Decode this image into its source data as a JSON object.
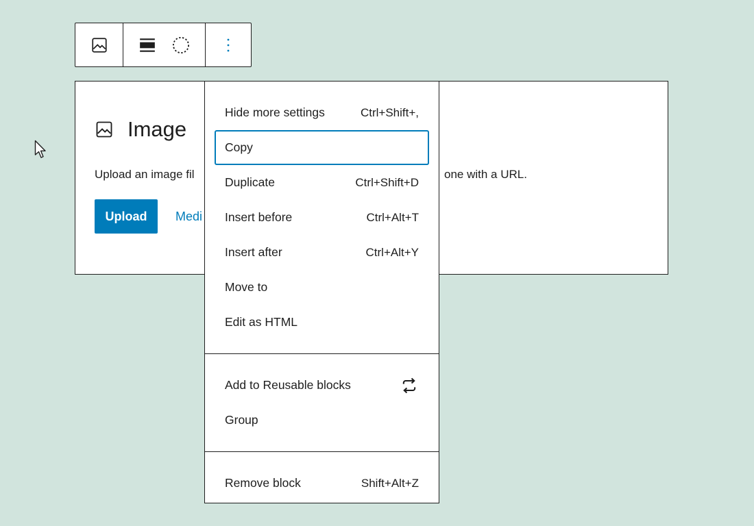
{
  "toolbar": {
    "buttons": [
      {
        "icon": "image-icon"
      },
      {
        "icon": "align-full-width-icon"
      },
      {
        "icon": "duotone-circle-icon"
      },
      {
        "icon": "more-options-icon"
      }
    ]
  },
  "block": {
    "title": "Image",
    "instructions": "Upload an image fil",
    "url_tail": "one with a URL.",
    "upload_label": "Upload",
    "media_label": "Medi"
  },
  "menu": {
    "group1": [
      {
        "label": "Hide more settings",
        "shortcut": "Ctrl+Shift+,"
      },
      {
        "label": "Copy",
        "shortcut": ""
      },
      {
        "label": "Duplicate",
        "shortcut": "Ctrl+Shift+D"
      },
      {
        "label": "Insert before",
        "shortcut": "Ctrl+Alt+T"
      },
      {
        "label": "Insert after",
        "shortcut": "Ctrl+Alt+Y"
      },
      {
        "label": "Move to",
        "shortcut": ""
      },
      {
        "label": "Edit as HTML",
        "shortcut": ""
      }
    ],
    "group2": [
      {
        "label": "Add to Reusable blocks",
        "icon": "reusable-block-icon"
      },
      {
        "label": "Group"
      }
    ],
    "group3": [
      {
        "label": "Remove block",
        "shortcut": "Shift+Alt+Z"
      }
    ]
  },
  "colors": {
    "background": "#d1e4dd",
    "accent": "#007cba",
    "border": "#1e1e1e"
  }
}
